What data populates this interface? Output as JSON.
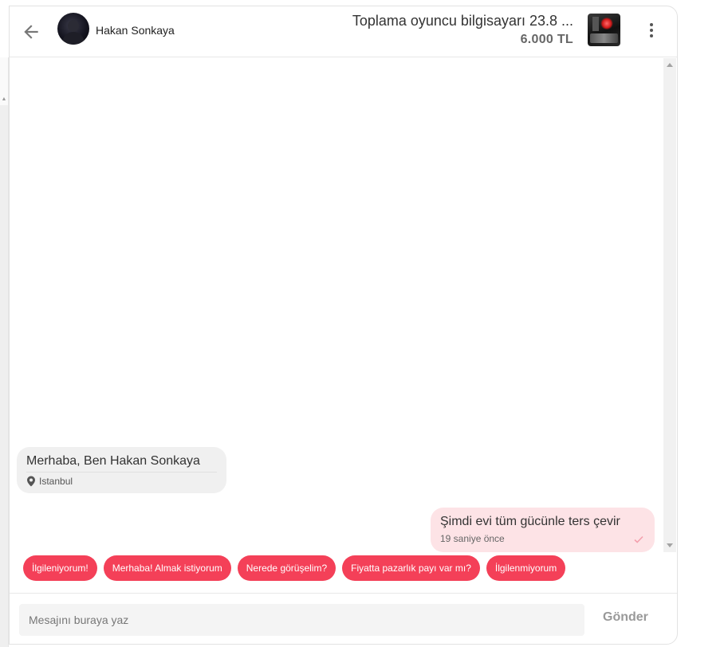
{
  "header": {
    "user_name": "Hakan Sonkaya",
    "product_title": "Toplama oyuncu bilgisayarı 23.8 ...",
    "product_price": "6.000 TL"
  },
  "messages": [
    {
      "direction": "incoming",
      "text": "Merhaba, Ben Hakan Sonkaya",
      "location": "Istanbul"
    },
    {
      "direction": "outgoing",
      "text": "Şimdi evi tüm gücünle ters çevir",
      "time": "19 saniye önce"
    }
  ],
  "quick_replies": [
    "İlgileniyorum!",
    "Merhaba! Almak istiyorum",
    "Nerede görüşelim?",
    "Fiyatta pazarlık payı var mı?",
    "İlgilenmiyorum"
  ],
  "composer": {
    "placeholder": "Mesajını buraya yaz",
    "send_label": "Gönder"
  },
  "colors": {
    "accent": "#f44058",
    "outgoing_bubble": "#fde3e6",
    "incoming_bubble": "#f0f0f0"
  },
  "icons": {
    "back": "arrow-left-icon",
    "menu": "more-vertical-icon",
    "location": "location-pin-icon",
    "sent": "check-icon"
  }
}
